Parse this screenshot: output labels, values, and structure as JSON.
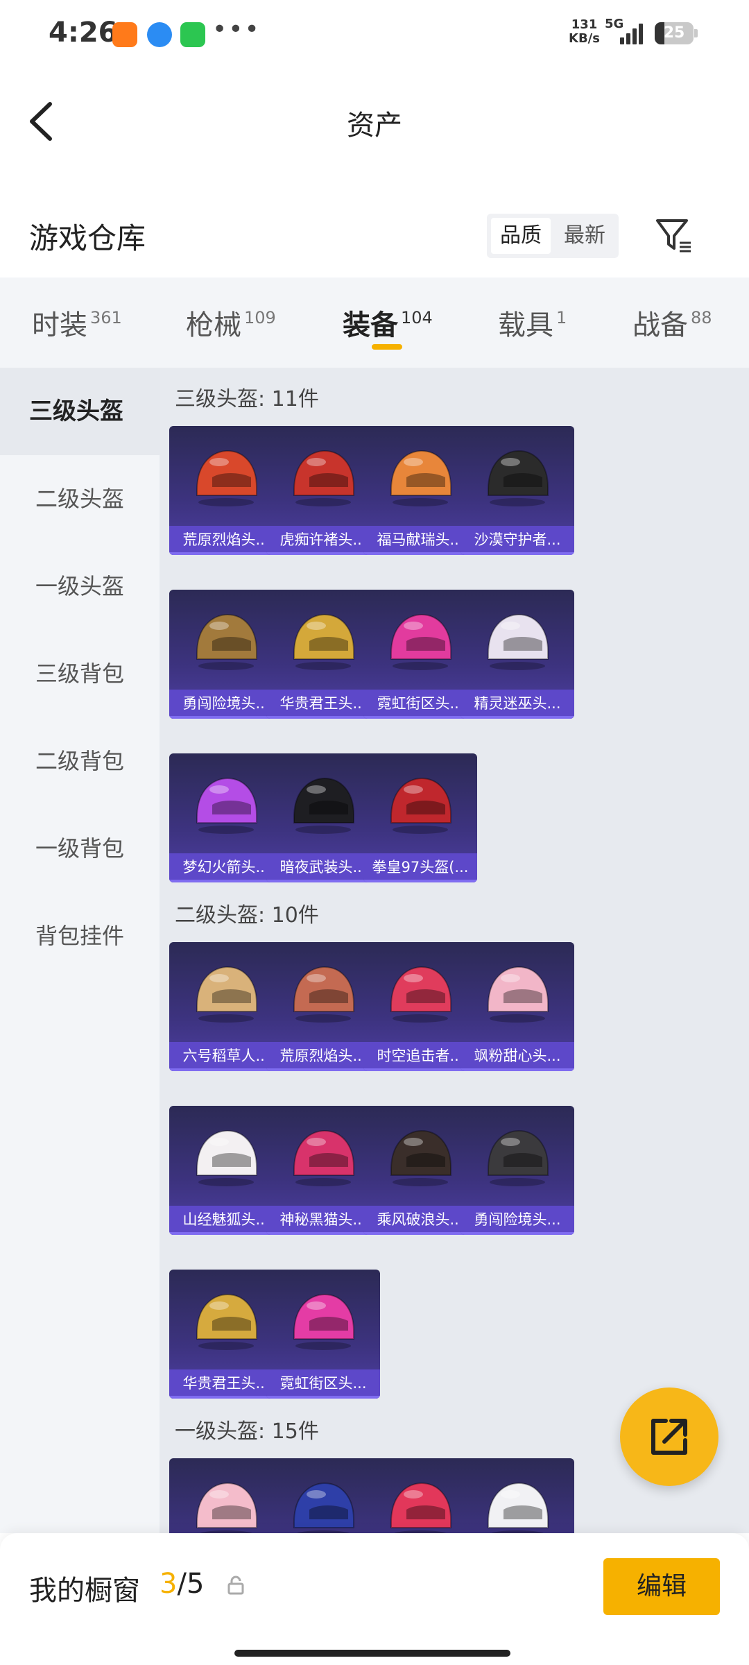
{
  "status_bar": {
    "time": "4:26",
    "more": "•••",
    "net_speed_value": "131",
    "net_speed_unit": "KB/s",
    "network": "5G",
    "battery": "25",
    "battery_level_percent": 25
  },
  "header": {
    "title": "资产"
  },
  "warehouse": {
    "title": "游戏仓库",
    "sort_options": [
      "品质",
      "最新"
    ],
    "sort_selected": "品质"
  },
  "category_tabs": [
    {
      "label": "时装",
      "count": "361"
    },
    {
      "label": "枪械",
      "count": "109"
    },
    {
      "label": "装备",
      "count": "104",
      "active": true
    },
    {
      "label": "载具",
      "count": "1"
    },
    {
      "label": "战备",
      "count": "88"
    }
  ],
  "sidebar": {
    "items": [
      "三级头盔",
      "二级头盔",
      "一级头盔",
      "三级背包",
      "二级背包",
      "一级背包",
      "背包挂件"
    ],
    "active": "三级头盔"
  },
  "sections": [
    {
      "title": "三级头盔: 11件",
      "items": [
        {
          "name": "荒原烈焰头...",
          "color": "#d9482b"
        },
        {
          "name": "虎痴许褚头...",
          "color": "#c8342c"
        },
        {
          "name": "福马献瑞头...",
          "color": "#e8863a"
        },
        {
          "name": "沙漠守护者...",
          "color": "#2b2b2b"
        },
        {
          "name": "勇闯险境头...",
          "color": "#a27a3c"
        },
        {
          "name": "华贵君王头...",
          "color": "#d4a83a"
        },
        {
          "name": "霓虹街区头...",
          "color": "#e23b9e"
        },
        {
          "name": "精灵迷巫头...",
          "color": "#e8e2ef"
        },
        {
          "name": "梦幻火箭头...",
          "color": "#b44de6"
        },
        {
          "name": "暗夜武装头...",
          "color": "#1e1e22"
        },
        {
          "name": "拳皇97头盔(...",
          "color": "#c0272d"
        }
      ]
    },
    {
      "title": "二级头盔: 10件",
      "items": [
        {
          "name": "六号稻草人...",
          "color": "#d9b27a"
        },
        {
          "name": "荒原烈焰头...",
          "color": "#c46a52"
        },
        {
          "name": "时空追击者...",
          "color": "#e03c5c"
        },
        {
          "name": "飒粉甜心头...",
          "color": "#f2b6c8"
        },
        {
          "name": "山经魅狐头...",
          "color": "#f3f0f2"
        },
        {
          "name": "神秘黑猫头...",
          "color": "#d8336b"
        },
        {
          "name": "乘风破浪头...",
          "color": "#3a2e2a"
        },
        {
          "name": "勇闯险境头...",
          "color": "#3b3a3d"
        },
        {
          "name": "华贵君王头...",
          "color": "#d6aa3e"
        },
        {
          "name": "霓虹街区头...",
          "color": "#e43ca5"
        }
      ]
    },
    {
      "title": "一级头盔: 15件",
      "items": [
        {
          "name": "",
          "color": "#f4bccb"
        },
        {
          "name": "",
          "color": "#2e3fa8"
        },
        {
          "name": "",
          "color": "#e2375a"
        },
        {
          "name": "",
          "color": "#f1f1f4"
        }
      ]
    }
  ],
  "showcase": {
    "label": "我的橱窗",
    "current": "3",
    "separator": "/",
    "total": "5",
    "edit_label": "编辑"
  },
  "colors": {
    "accent": "#f6b100",
    "card_bg": "#3d3380",
    "card_label_bg": "#5d48c9"
  }
}
